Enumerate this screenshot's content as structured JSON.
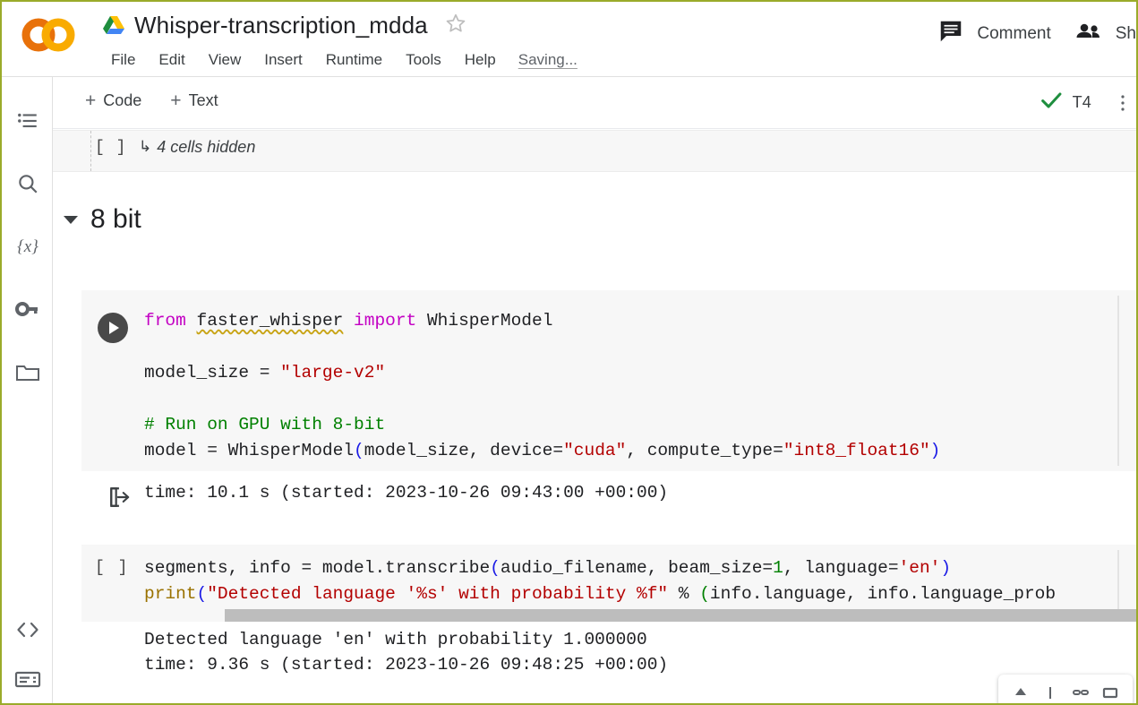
{
  "header": {
    "logo_name": "colab-logo",
    "drive_icon": "drive-icon",
    "doc_title": "Whisper-transcription_mdda",
    "star_icon": "star-outline-icon",
    "menus": [
      "File",
      "Edit",
      "View",
      "Insert",
      "Runtime",
      "Tools",
      "Help"
    ],
    "saving_status": "Saving...",
    "comment_label": "Comment",
    "comment_icon": "comment-icon",
    "share_label": "Sh",
    "share_icon": "people-share-icon"
  },
  "left_rail": {
    "items": [
      {
        "name": "table-of-contents-icon",
        "label": "Table of contents"
      },
      {
        "name": "search-icon",
        "label": "Find and replace"
      },
      {
        "name": "variables-icon",
        "label": "Variables"
      },
      {
        "name": "secrets-key-icon",
        "label": "Secrets"
      },
      {
        "name": "files-folder-icon",
        "label": "Files"
      }
    ],
    "bottom_items": [
      {
        "name": "code-snippets-icon",
        "label": "Code snippets"
      },
      {
        "name": "terminal-icon",
        "label": "Terminal"
      }
    ]
  },
  "toolbar": {
    "add_code_label": "Code",
    "add_text_label": "Text",
    "plus_glyph": "+",
    "runtime_ok_icon": "green-check-icon",
    "accelerator_label": "T4",
    "overflow_icon": "more-vert-icon"
  },
  "notebook": {
    "hidden_cells": {
      "prompt": "[ ]",
      "hook_glyph": "↳",
      "label": "4 cells hidden"
    },
    "section": {
      "caret_icon": "caret-down-icon",
      "title": "8 bit"
    },
    "cell_1": {
      "run_icon": "run-cell-play-icon",
      "code_lines": [
        "from faster_whisper import WhisperModel",
        "",
        "model_size = \"large-v2\"",
        "",
        "# Run on GPU with 8-bit",
        "model = WhisperModel(model_size, device=\"cuda\", compute_type=\"int8_float16\")"
      ],
      "tokens": {
        "kw_from": "from",
        "module": "faster_whisper",
        "kw_import": "import",
        "class_name": "WhisperModel",
        "var_model_size": "model_size",
        "str_large_v2": "\"large-v2\"",
        "comment": "# Run on GPU with 8-bit",
        "str_cuda": "\"cuda\"",
        "str_int8": "\"int8_float16\""
      }
    },
    "output_1": {
      "icon": "output-arrow-icon",
      "text": "time: 10.1 s (started: 2023-10-26 09:43:00 +00:00)"
    },
    "cell_2": {
      "prompt": "[ ]",
      "code_lines": [
        "segments, info = model.transcribe(audio_filename, beam_size=1, language='en')",
        "print(\"Detected language '%s' with probability %f\" % (info.language, info.language_prob"
      ],
      "tokens": {
        "fn_print": "print",
        "num_beam_size": "1",
        "str_en": "'en'",
        "str_detected": "\"Detected language '%s' with probability %f\""
      },
      "scrollbar": "horizontal-scrollbar"
    },
    "output_2": {
      "line_1": "Detected language 'en' with probability 1.000000",
      "line_2": "time: 9.36 s (started: 2023-10-26 09:48:25 +00:00)"
    }
  },
  "float_toolbar": {
    "items": [
      {
        "name": "move-up-icon"
      },
      {
        "name": "move-down-icon"
      },
      {
        "name": "link-icon"
      },
      {
        "name": "delete-icon"
      }
    ]
  },
  "colors": {
    "keyword": "#c300c3",
    "string": "#b30000",
    "comment": "#008000",
    "number": "#008000",
    "builtin": "#9a7200",
    "paren": "#1a1ae6",
    "cell_bg": "#f7f7f7",
    "accent_green": "#1e8e3e",
    "logo_orange_dark": "#e8710a",
    "logo_orange_light": "#f9ab00"
  }
}
